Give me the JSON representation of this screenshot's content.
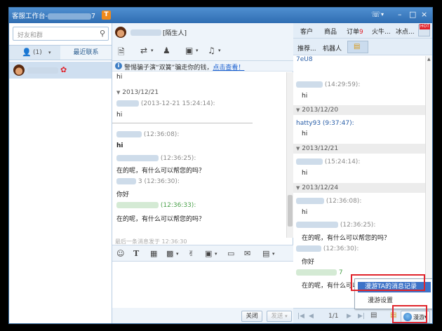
{
  "window": {
    "title": "客服工作台-",
    "title_suffix": "7",
    "badge": "T",
    "controls": [
      "☏",
      "▾",
      "–",
      "□",
      "×"
    ]
  },
  "left": {
    "search_placeholder": "好友和群",
    "tab_contacts_count": "(1)",
    "tab_recent": "最近联系"
  },
  "chat": {
    "peer_name": "[陌生人]",
    "notice_text": "警惕骗子演“双簧”骗走你的钱，",
    "notice_link": "点击查看！",
    "messages": [
      {
        "kind": "text",
        "text": "hi"
      },
      {
        "kind": "day",
        "text": "2013/12/21"
      },
      {
        "kind": "meta",
        "text": "(2013-12-21 15:24:14):"
      },
      {
        "kind": "text",
        "text": "hi"
      },
      {
        "kind": "meta",
        "text": "(12:36:08):"
      },
      {
        "kind": "text",
        "text": "hi"
      },
      {
        "kind": "meta",
        "text": "(12:36:25):"
      },
      {
        "kind": "text",
        "text": "在的呢，有什么可以帮您的吗？"
      },
      {
        "kind": "meta",
        "text": "3 (12:36:30):"
      },
      {
        "kind": "text",
        "text": "你好"
      },
      {
        "kind": "meta",
        "text": "(12:36:33):"
      },
      {
        "kind": "text",
        "text": "在的呢，有什么可以帮您的吗？"
      }
    ],
    "last_msg": "最后一条消息发于 12:36:30",
    "close_btn": "关闭",
    "send_btn": "发送"
  },
  "right": {
    "tabs": [
      "客户",
      "商品",
      "订单",
      "火牛...",
      "冰点..."
    ],
    "order_badge": "9",
    "hot_label": "HOT",
    "sub_tabs": [
      "推荐...",
      "机器人"
    ],
    "messages": [
      {
        "kind": "blue",
        "text": "7eU8"
      },
      {
        "kind": "meta",
        "text": "(14:29:59):"
      },
      {
        "kind": "text",
        "text": "hi"
      },
      {
        "kind": "day",
        "text": "2013/12/20"
      },
      {
        "kind": "blue",
        "text": "hatty93 (9:37:47):"
      },
      {
        "kind": "text",
        "text": "hi"
      },
      {
        "kind": "day",
        "text": "2013/12/21"
      },
      {
        "kind": "meta",
        "text": "(15:24:14):"
      },
      {
        "kind": "text",
        "text": "hi"
      },
      {
        "kind": "day",
        "text": "2013/12/24"
      },
      {
        "kind": "meta",
        "text": "(12:36:08):"
      },
      {
        "kind": "text",
        "text": "hi"
      },
      {
        "kind": "meta",
        "text": "(12:36:25):"
      },
      {
        "kind": "text",
        "text": "在的呢，有什么可以帮您的吗？"
      },
      {
        "kind": "meta",
        "text": "(12:36:30):"
      },
      {
        "kind": "text",
        "text": "你好"
      },
      {
        "kind": "meta",
        "text": "7"
      },
      {
        "kind": "text",
        "text": "在的呢，有什么可以"
      }
    ],
    "page": "1/1",
    "roam_label": "漫游",
    "menu_items": [
      "漫游TA的消息记录",
      "漫游设置"
    ]
  }
}
